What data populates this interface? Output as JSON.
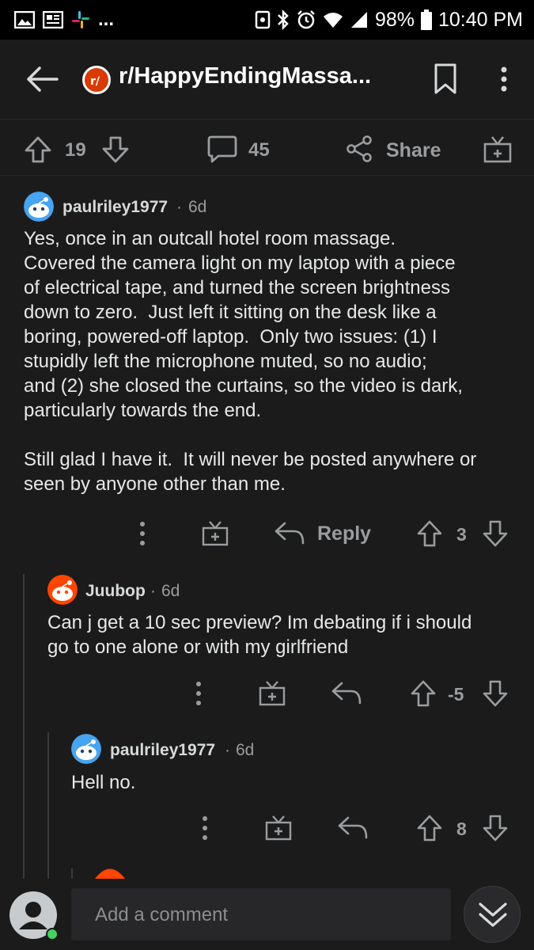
{
  "status": {
    "battery": "98%",
    "time": "10:40 PM",
    "dots": "..."
  },
  "header": {
    "subreddit": "r/HappyEndingMassa..."
  },
  "post_actions": {
    "upvotes": "19",
    "comments": "45",
    "share": "Share"
  },
  "comments": [
    {
      "author": "paulriley1977",
      "age": "6d",
      "body": "Yes, once in an outcall hotel room massage.\nCovered the camera light on my laptop with a piece\nof electrical tape, and turned the screen brightness\ndown to zero.  Just left it sitting on the desk like a\nboring, powered-off laptop.  Only two issues: (1) I\nstupidly left the microphone muted, so no audio;\nand (2) she closed the curtains, so the video is dark,\nparticularly towards the end.\n\nStill glad I have it.  It will never be posted anywhere or\nseen by anyone other than me.",
      "reply_label": "Reply",
      "score": "3"
    },
    {
      "author": "Juubop",
      "age": "6d",
      "body": "Can j get a 10 sec preview? Im debating if i should\ngo to one alone or with my girlfriend",
      "score": "-5"
    },
    {
      "author": "paulriley1977",
      "age": "6d",
      "body": "Hell no.",
      "score": "8"
    }
  ],
  "composer": {
    "placeholder": "Add a comment"
  },
  "colors": {
    "background": "#1b1b1b",
    "text": "#d7dadc",
    "muted": "#9a9da0",
    "brand": "#d93a00",
    "online": "#46d160"
  }
}
